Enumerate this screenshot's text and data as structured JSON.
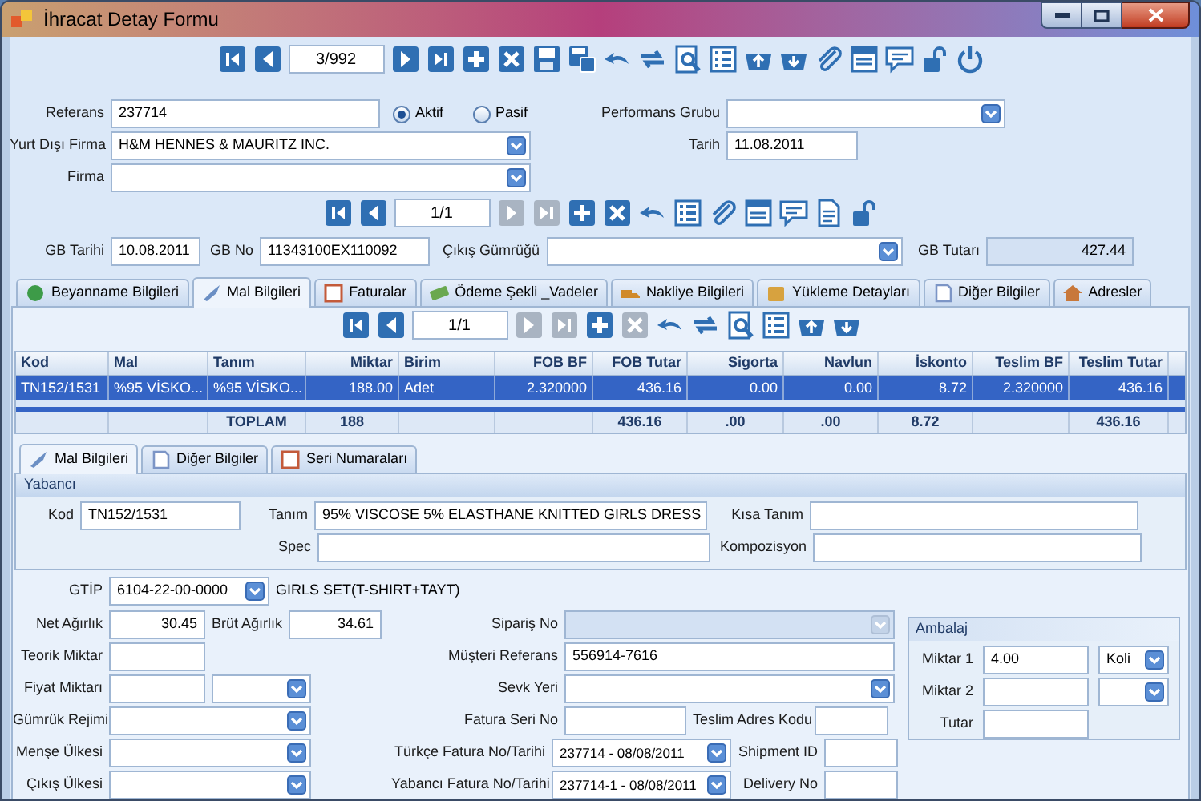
{
  "window": {
    "title": "İhracat Detay Formu"
  },
  "main_toolbar": {
    "counter": "3/992",
    "buttons": [
      {
        "kind": "first",
        "disabled": false
      },
      {
        "kind": "prev",
        "disabled": false
      },
      {
        "kind": "counter"
      },
      {
        "kind": "next",
        "disabled": false
      },
      {
        "kind": "last",
        "disabled": false
      },
      {
        "kind": "add",
        "disabled": false
      },
      {
        "kind": "delete",
        "disabled": false
      },
      {
        "kind": "save",
        "disabled": false
      },
      {
        "kind": "save_as",
        "disabled": false
      },
      {
        "kind": "undo",
        "disabled": false
      },
      {
        "kind": "refresh",
        "disabled": false
      },
      {
        "kind": "preview",
        "disabled": false
      },
      {
        "kind": "list",
        "disabled": false
      },
      {
        "kind": "basket_up",
        "disabled": false
      },
      {
        "kind": "basket_down",
        "disabled": false
      },
      {
        "kind": "attach",
        "disabled": false
      },
      {
        "kind": "form",
        "disabled": false
      },
      {
        "kind": "comment",
        "disabled": false
      },
      {
        "kind": "lock",
        "disabled": false
      },
      {
        "kind": "power",
        "disabled": false
      }
    ]
  },
  "referans": {
    "label": "Referans",
    "value": "237714"
  },
  "status": [
    {
      "label": "Aktif",
      "selected": true
    },
    {
      "label": "Pasif",
      "selected": false
    }
  ],
  "performans_grubu": {
    "label": "Performans Grubu"
  },
  "yurt_disi_firma": {
    "label": "Yurt Dışı Firma",
    "value": "H&M HENNES & MAURITZ INC."
  },
  "tarih": {
    "label": "Tarih",
    "value": "11.08.2011"
  },
  "firma": {
    "label": "Firma"
  },
  "gb_toolbar": {
    "counter": "1/1",
    "buttons": [
      {
        "kind": "first",
        "disabled": false
      },
      {
        "kind": "prev",
        "disabled": false
      },
      {
        "kind": "counter"
      },
      {
        "kind": "next",
        "disabled": true
      },
      {
        "kind": "last",
        "disabled": true
      },
      {
        "kind": "add",
        "disabled": false
      },
      {
        "kind": "delete",
        "disabled": false
      },
      {
        "kind": "undo",
        "disabled": false
      },
      {
        "kind": "list",
        "disabled": false
      },
      {
        "kind": "attach",
        "disabled": false
      },
      {
        "kind": "form",
        "disabled": false
      },
      {
        "kind": "comment",
        "disabled": false
      },
      {
        "kind": "document",
        "disabled": false
      },
      {
        "kind": "lock",
        "disabled": false
      }
    ]
  },
  "gb_tarihi": {
    "label": "GB Tarihi",
    "value": "10.08.2011"
  },
  "gb_no": {
    "label": "GB No",
    "value": "11343100EX110092"
  },
  "cikis_gumrugu": {
    "label": "Çıkış Gümrüğü"
  },
  "gb_tutari": {
    "label": "GB Tutarı",
    "value": "427.44"
  },
  "tabs": [
    {
      "label": "Beyanname Bilgileri",
      "selected": false
    },
    {
      "label": "Mal Bilgileri",
      "selected": true
    },
    {
      "label": "Faturalar",
      "selected": false
    },
    {
      "label": "Ödeme Şekli _Vadeler",
      "selected": false
    },
    {
      "label": "Nakliye Bilgileri",
      "selected": false
    },
    {
      "label": "Yükleme Detayları",
      "selected": false
    },
    {
      "label": "Diğer Bilgiler",
      "selected": false
    },
    {
      "label": "Adresler",
      "selected": false
    }
  ],
  "items_toolbar": {
    "counter": "1/1",
    "buttons": [
      {
        "kind": "first",
        "disabled": false
      },
      {
        "kind": "prev",
        "disabled": false
      },
      {
        "kind": "counter"
      },
      {
        "kind": "next",
        "disabled": true
      },
      {
        "kind": "last",
        "disabled": true
      },
      {
        "kind": "add",
        "disabled": false
      },
      {
        "kind": "delete",
        "disabled": true
      },
      {
        "kind": "undo",
        "disabled": false
      },
      {
        "kind": "refresh",
        "disabled": false
      },
      {
        "kind": "preview",
        "disabled": false
      },
      {
        "kind": "list",
        "disabled": false
      },
      {
        "kind": "basket_up",
        "disabled": false
      },
      {
        "kind": "basket_down",
        "disabled": false
      }
    ]
  },
  "items_table": {
    "columns": [
      "Kod",
      "Mal",
      "Tanım",
      "Miktar",
      "Birim",
      "FOB BF",
      "FOB Tutar",
      "Sigorta",
      "Navlun",
      "İskonto",
      "Teslim BF",
      "Teslim Tutar"
    ],
    "rows": [
      {
        "selected": true,
        "cells": [
          "TN152/1531",
          "%95 VİSKO...",
          "%95 VİSKO...",
          "188.00",
          "Adet",
          "2.320000",
          "436.16",
          "0.00",
          "0.00",
          "8.72",
          "2.320000",
          "436.16"
        ]
      }
    ],
    "total": {
      "label": "TOPLAM",
      "miktar": "188",
      "fob_tutar": "436.16",
      "sigorta": ".00",
      "navlun": ".00",
      "iskonto": "8.72",
      "teslim_tutar": "436.16"
    }
  },
  "detail_tabs": [
    {
      "label": "Mal Bilgileri",
      "selected": true
    },
    {
      "label": "Diğer Bilgiler",
      "selected": false
    },
    {
      "label": "Seri Numaraları",
      "selected": false
    }
  ],
  "yabanci": {
    "title": "Yabancı",
    "kod": {
      "label": "Kod",
      "value": "TN152/1531"
    },
    "tanim": {
      "label": "Tanım",
      "value": "95% VISCOSE 5% ELASTHANE KNITTED GIRLS DRESS"
    },
    "kisa_tanim": {
      "label": "Kısa Tanım"
    },
    "spec": {
      "label": "Spec"
    },
    "kompozisyon": {
      "label": "Kompozisyon"
    }
  },
  "gtip": {
    "label": "GTİP",
    "value": "6104-22-00-0000",
    "description": "GIRLS SET(T-SHIRT+TAYT)"
  },
  "net_agirlik": {
    "label": "Net Ağırlık",
    "value": "30.45"
  },
  "brut_agirlik": {
    "label": "Brüt Ağırlık",
    "value": "34.61"
  },
  "teorik_miktar": {
    "label": "Teorik Miktar"
  },
  "fiyat_miktari": {
    "label": "Fiyat Miktarı"
  },
  "gumruk_rejimi": {
    "label": "Gümrük Rejimi"
  },
  "mense_ulkesi": {
    "label": "Menşe Ülkesi"
  },
  "cikis_ulkesi": {
    "label": "Çıkış Ülkesi"
  },
  "siparis_no": {
    "label": "Sipariş No",
    "disabled": true
  },
  "musteri_referans": {
    "label": "Müşteri Referans",
    "value": "556914-7616"
  },
  "sevk_yeri": {
    "label": "Sevk Yeri"
  },
  "fatura_seri_no": {
    "label": "Fatura Seri No"
  },
  "teslim_adres_kodu": {
    "label": "Teslim Adres Kodu"
  },
  "turkce_fatura": {
    "label": "Türkçe Fatura No/Tarihi",
    "value": "237714 - 08/08/2011"
  },
  "shipment_id": {
    "label": "Shipment ID"
  },
  "yabanci_fatura": {
    "label": "Yabancı Fatura No/Tarihi",
    "value": "237714-1 - 08/08/2011"
  },
  "delivery_no": {
    "label": "Delivery No"
  },
  "ambalaj": {
    "title": "Ambalaj",
    "miktar_1": {
      "label": "Miktar 1",
      "value": "4.00",
      "unit": "Koli"
    },
    "miktar_2": {
      "label": "Miktar 2"
    },
    "tutar": {
      "label": "Tutar"
    }
  }
}
